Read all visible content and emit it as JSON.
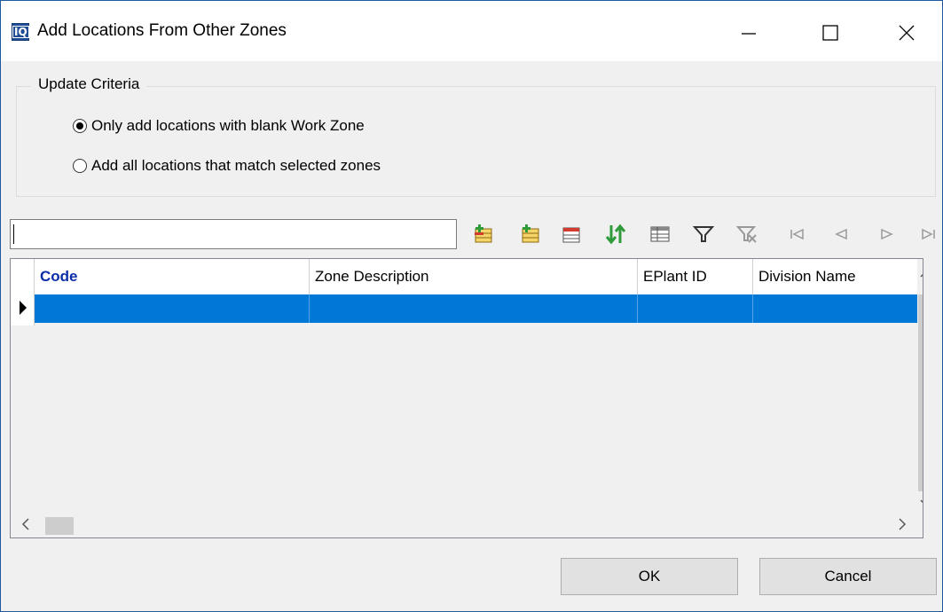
{
  "window": {
    "title": "Add Locations From Other Zones",
    "app_icon_text": "IQ",
    "controls": [
      "minimize-icon",
      "maximize-icon",
      "close-icon"
    ]
  },
  "update_criteria": {
    "legend": "Update Criteria",
    "options": [
      {
        "label": "Only add locations with blank Work Zone",
        "selected": true
      },
      {
        "label": "Add all locations that match selected zones",
        "selected": false
      }
    ]
  },
  "search": {
    "value": "",
    "placeholder": ""
  },
  "toolbar": {
    "icons": [
      "insert-record-icon",
      "append-record-icon",
      "delete-record-icon",
      "sort-icon",
      "grid-view-icon",
      "filter-icon",
      "clear-filter-icon",
      "first-record-icon",
      "prior-record-icon",
      "next-record-icon",
      "last-record-icon"
    ]
  },
  "grid": {
    "columns": [
      "Code",
      "Zone Description",
      "EPlant ID",
      "Division Name"
    ],
    "rows": [
      [
        "",
        "",
        "",
        ""
      ]
    ],
    "selected_row": 0
  },
  "buttons": {
    "ok": "OK",
    "cancel": "Cancel"
  },
  "colors": {
    "selection": "#0078d7",
    "header_code": "#0b2ea8",
    "app_icon": "#1f4e96"
  }
}
